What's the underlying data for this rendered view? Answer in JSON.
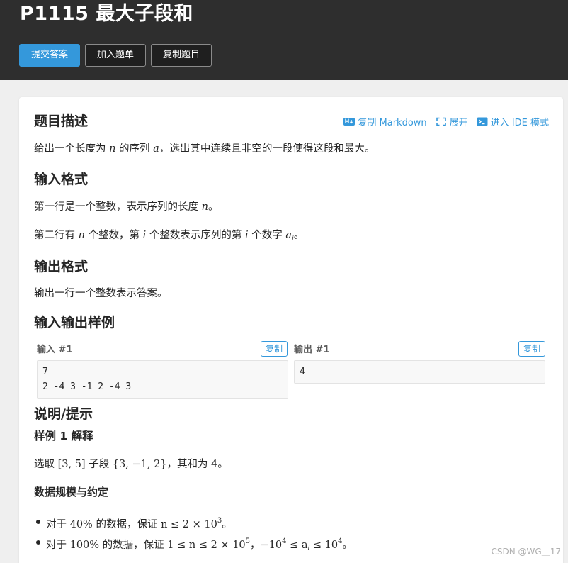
{
  "header": {
    "title": "P1115 最大子段和",
    "buttons": {
      "submit": "提交答案",
      "add_to_list": "加入题单",
      "copy_problem": "复制题目"
    }
  },
  "toolbar": {
    "copy_markdown": "复制 Markdown",
    "expand": "展开",
    "ide_mode": "进入 IDE 模式"
  },
  "description": {
    "heading": "题目描述",
    "text_1": "给出一个长度为 ",
    "var_n": "n",
    "text_2": " 的序列 ",
    "var_a": "a",
    "text_3": "，选出其中连续且非空的一段使得这段和最大。"
  },
  "input_format": {
    "heading": "输入格式",
    "line1_text": "第一行是一个整数，表示序列的长度 ",
    "line1_var": "n",
    "line1_end": "。",
    "line2_t1": "第二行有 ",
    "line2_v1": "n",
    "line2_t2": " 个整数，第 ",
    "line2_v2": "i",
    "line2_t3": " 个整数表示序列的第 ",
    "line2_v3": "i",
    "line2_t4": " 个数字 ",
    "line2_v4": "a",
    "line2_v4_sub": "i",
    "line2_end": "。"
  },
  "output_format": {
    "heading": "输出格式",
    "text": "输出一行一个整数表示答案。"
  },
  "samples": {
    "heading": "输入输出样例",
    "input_label": "输入 #1",
    "output_label": "输出 #1",
    "copy_label": "复制",
    "input_content": "7\n2 -4 3 -1 2 -4 3",
    "output_content": "4"
  },
  "hints": {
    "heading": "说明/提示",
    "sample_explain_heading": "样例 1 解释",
    "explain_t1": "选取 ",
    "explain_m1": "[3, 5]",
    "explain_t2": " 子段 ",
    "explain_m2": "{3, −1, 2}",
    "explain_t3": "，其和为 ",
    "explain_m3": "4",
    "explain_end": "。",
    "constraints_heading": "数据规模与约定",
    "c1_t1": "对于 ",
    "c1_pct": "40%",
    "c1_t2": " 的数据，保证 ",
    "c1_m1": "n ≤ 2 × 10",
    "c1_sup": "3",
    "c1_end": "。",
    "c2_t1": "对于 ",
    "c2_pct": "100%",
    "c2_t2": " 的数据，保证 ",
    "c2_m1": "1 ≤ n ≤ 2 × 10",
    "c2_sup1": "5",
    "c2_sep": "，",
    "c2_m2": "−10",
    "c2_sup2": "4",
    "c2_m3": " ≤ a",
    "c2_sub": "i",
    "c2_m4": " ≤ 10",
    "c2_sup3": "4",
    "c2_end": "。"
  },
  "watermark": "CSDN @WG＿17",
  "colors": {
    "accent": "#3498db",
    "header_bg": "#2e2e2e",
    "page_bg": "#efefef"
  }
}
